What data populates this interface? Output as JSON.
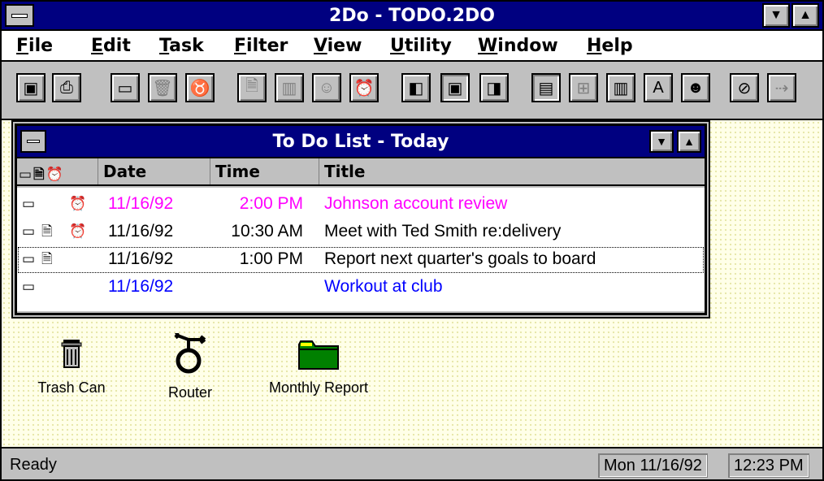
{
  "app": {
    "title": "2Do - TODO.2DO"
  },
  "menu": {
    "items": [
      {
        "label": "File",
        "u": "F",
        "rest": "ile"
      },
      {
        "label": "Edit",
        "u": "E",
        "rest": "dit"
      },
      {
        "label": "Task",
        "u": "T",
        "rest": "ask"
      },
      {
        "label": "Filter",
        "u": "F",
        "rest": "ilter",
        "pre": ""
      },
      {
        "label": "View",
        "u": "V",
        "rest": "iew"
      },
      {
        "label": "Utility",
        "u": "U",
        "rest": "tility"
      },
      {
        "label": "Window",
        "u": "W",
        "rest": "indow"
      },
      {
        "label": "Help",
        "u": "H",
        "rest": "elp"
      }
    ]
  },
  "toolbar": {
    "buttons": [
      {
        "name": "save-icon",
        "glyph": "💾",
        "enabled": true
      },
      {
        "name": "print-icon",
        "glyph": "🖶",
        "enabled": true
      },
      {
        "name": "new-task-icon",
        "glyph": "▭",
        "enabled": true
      },
      {
        "name": "trash-icon",
        "glyph": "🗑",
        "enabled": false
      },
      {
        "name": "router-icon",
        "glyph": "♉",
        "enabled": false
      },
      {
        "name": "note-icon",
        "glyph": "🗎",
        "enabled": false
      },
      {
        "name": "chart-icon",
        "glyph": "▥",
        "enabled": false
      },
      {
        "name": "person-icon",
        "glyph": "☺",
        "enabled": false
      },
      {
        "name": "alarm-icon",
        "glyph": "⏰",
        "enabled": false
      },
      {
        "name": "view-left-icon",
        "glyph": "◧",
        "enabled": true
      },
      {
        "name": "view-center-icon",
        "glyph": "▣",
        "enabled": true
      },
      {
        "name": "view-right-icon",
        "glyph": "◨",
        "enabled": true
      },
      {
        "name": "filter-list-icon",
        "glyph": "▤",
        "enabled": true
      },
      {
        "name": "filter-tree-icon",
        "glyph": "⊞",
        "enabled": false
      },
      {
        "name": "filter-chart-icon",
        "glyph": "▥",
        "enabled": true
      },
      {
        "name": "filter-text-icon",
        "glyph": "A",
        "enabled": true
      },
      {
        "name": "filter-person-icon",
        "glyph": "☻",
        "enabled": true
      },
      {
        "name": "no-filter-icon",
        "glyph": "⊘",
        "enabled": true
      },
      {
        "name": "export-icon",
        "glyph": "⇢",
        "enabled": false
      }
    ]
  },
  "todo_window": {
    "title": "To Do List - Today",
    "columns": {
      "icons": "▭🗎⏰",
      "date": "Date",
      "time": "Time",
      "title": "Title"
    },
    "rows": [
      {
        "has_task": true,
        "has_note": false,
        "has_alarm": true,
        "date": "11/16/92",
        "time": "2:00 PM",
        "title": "Johnson account review",
        "color": "#ff00ff"
      },
      {
        "has_task": true,
        "has_note": true,
        "has_alarm": true,
        "date": "11/16/92",
        "time": "10:30 AM",
        "title": "Meet with Ted Smith re:delivery",
        "color": "#000000"
      },
      {
        "has_task": true,
        "has_note": true,
        "has_alarm": false,
        "date": "11/16/92",
        "time": "1:00 PM",
        "title": "Report next quarter's goals to board",
        "color": "#000000"
      },
      {
        "has_task": true,
        "has_note": false,
        "has_alarm": false,
        "date": "11/16/92",
        "time": "",
        "title": "Workout at club",
        "color": "#0000ff"
      }
    ]
  },
  "desktop": {
    "icons": [
      {
        "label": "Trash Can"
      },
      {
        "label": "Router"
      },
      {
        "label": "Monthly Report"
      }
    ]
  },
  "status": {
    "text": "Ready",
    "date": "Mon 11/16/92",
    "time": "12:23 PM"
  },
  "colors": {
    "title_bar": "#000080",
    "chrome": "#c0c0c0",
    "folder": "#008000"
  }
}
